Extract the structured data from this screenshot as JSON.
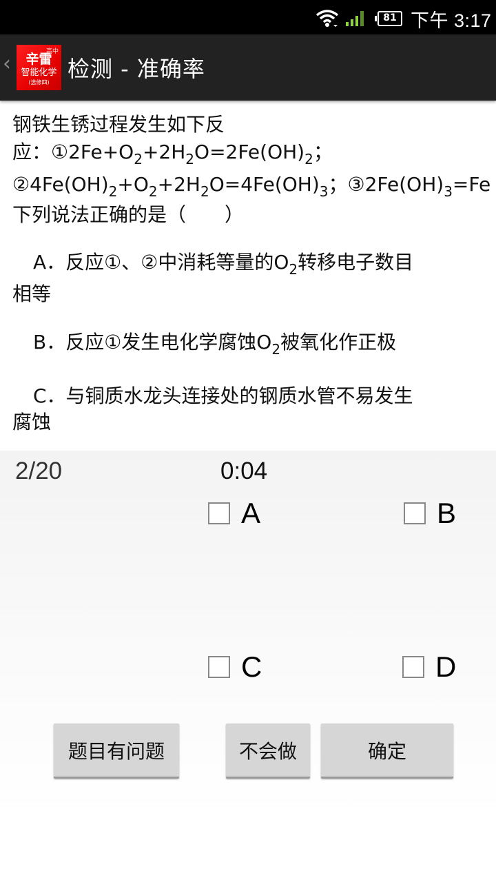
{
  "status_bar": {
    "battery": "81",
    "time": "下午 3:17",
    "icons": [
      "wifi-icon",
      "cellular-signal-icon",
      "battery-icon"
    ]
  },
  "action_bar": {
    "back_icon": "‹",
    "logo": {
      "top": "高中",
      "main": "辛雷",
      "sub": "智能化学",
      "small": "(选修四)"
    },
    "title": "检测 - 准确率"
  },
  "question": {
    "line1": "钢铁生锈过程发生如下反",
    "line2": {
      "a": "应：①2Fe+O",
      "s1": "2",
      "b": "+2H",
      "s2": "2",
      "c": "O=2Fe(OH)",
      "s3": "2",
      "d": "；"
    },
    "line3": {
      "a": "②4Fe(OH)",
      "s1": "2",
      "b": "+O",
      "s2": "2",
      "c": "+2H",
      "s3": "2",
      "d": "O=4Fe(OH)",
      "s4": "3",
      "e": "；③2Fe(OH)",
      "s5": "3",
      "f": "=Fe"
    },
    "line4": "下列说法正确的是（　　）",
    "options": {
      "A": {
        "a": "A．反应①、②中消耗等量的O",
        "s": "2",
        "b": "转移电子数目",
        "line2": "相等"
      },
      "B": {
        "a": "B．反应①发生电化学腐蚀O",
        "s": "2",
        "b": "被氧化作正极"
      },
      "C": {
        "a": "C．与铜质水龙头连接处的钢质水管不易发生",
        "line2": "腐蚀"
      }
    }
  },
  "panel": {
    "progress": "2/20",
    "timer": "0:04",
    "choices": [
      {
        "label": "A",
        "checked": false
      },
      {
        "label": "B",
        "checked": false
      },
      {
        "label": "C",
        "checked": false
      },
      {
        "label": "D",
        "checked": false
      }
    ],
    "buttons": {
      "report": "题目有问题",
      "skip": "不会做",
      "confirm": "确定"
    }
  }
}
